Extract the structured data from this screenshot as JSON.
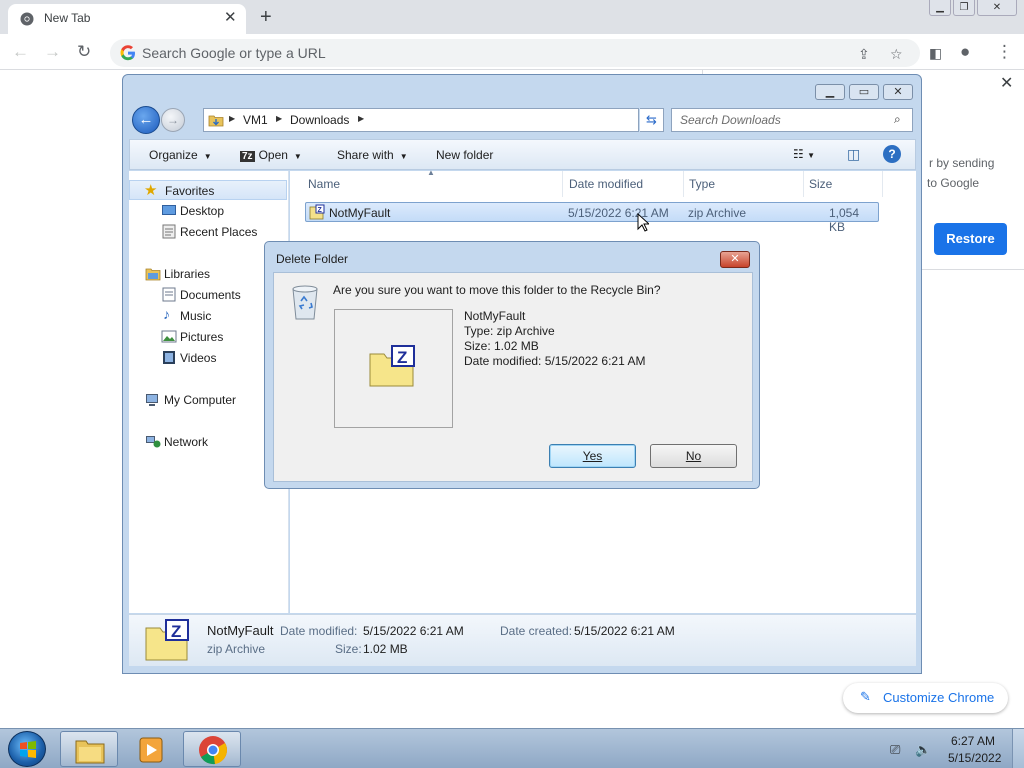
{
  "browser": {
    "tab_title": "New Tab",
    "tab_close": "✕",
    "new_tab": "+",
    "omnibox_placeholder": "Search Google or type a URL",
    "restore_text_1": "r by sending",
    "restore_text_2": "to Google",
    "restore_button": "Restore",
    "customize_label": "Customize Chrome"
  },
  "explorer": {
    "breadcrumbs": [
      "VM1",
      "Downloads"
    ],
    "search_placeholder": "Search Downloads",
    "commands": {
      "organize": "Organize",
      "open": "Open",
      "share_with": "Share with",
      "new_folder": "New folder"
    },
    "nav": {
      "favorites": "Favorites",
      "desktop": "Desktop",
      "recent_places": "Recent Places",
      "libraries": "Libraries",
      "documents": "Documents",
      "music": "Music",
      "pictures": "Pictures",
      "videos": "Videos",
      "my_computer": "My Computer",
      "network": "Network"
    },
    "columns": {
      "name": "Name",
      "date_modified": "Date modified",
      "type": "Type",
      "size": "Size"
    },
    "file": {
      "name": "NotMyFault",
      "date_modified": "5/15/2022 6:21 AM",
      "type": "zip Archive",
      "size": "1,054 KB"
    },
    "details": {
      "name": "NotMyFault",
      "type": "zip Archive",
      "date_modified_label": "Date modified:",
      "date_modified": "5/15/2022 6:21 AM",
      "date_created_label": "Date created:",
      "date_created": "5/15/2022 6:21 AM",
      "size_label": "Size:",
      "size": "1.02 MB"
    }
  },
  "dialog": {
    "title": "Delete Folder",
    "question": "Are you sure you want to move this folder to the Recycle Bin?",
    "item_name": "NotMyFault",
    "item_type": "Type: zip Archive",
    "item_size": "Size: 1.02 MB",
    "item_date": "Date modified: 5/15/2022 6:21 AM",
    "yes_label": "Yes",
    "no_label": "No"
  },
  "taskbar": {
    "time": "6:27 AM",
    "date": "5/15/2022"
  },
  "colors": {
    "chrome_blue": "#1a73e8",
    "explorer_frame": "#c4d8ee",
    "selection": "#c4dcf8"
  }
}
